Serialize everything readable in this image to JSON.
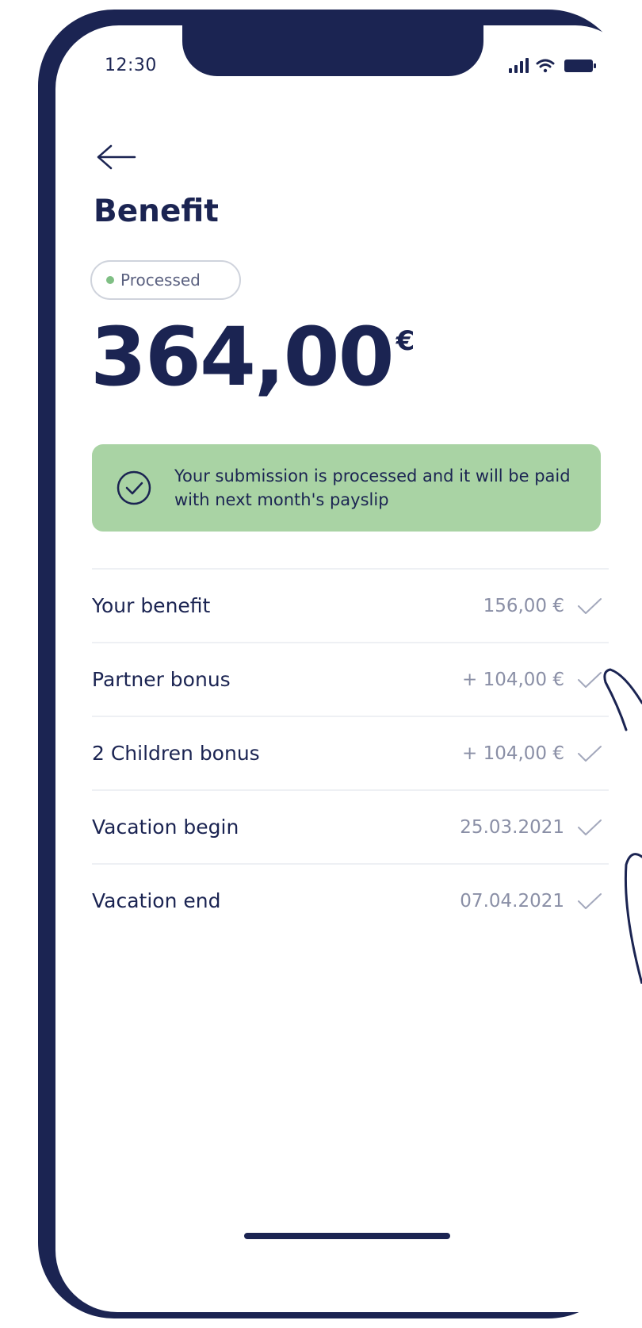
{
  "status_bar": {
    "time": "12:30"
  },
  "header": {
    "back_icon": "arrow-left-icon",
    "title": "Benefit"
  },
  "status_badge": {
    "label": "Processed",
    "dot_color": "#7fbf84"
  },
  "amount": {
    "value": "364,00",
    "currency": "€"
  },
  "info_banner": {
    "icon": "check-circle-icon",
    "message": "Your submission is processed and it will be paid with next month's payslip",
    "background": "#a9d3a4"
  },
  "rows": [
    {
      "label": "Your benefit",
      "value": "156,00 €"
    },
    {
      "label": "Partner bonus",
      "value": "+ 104,00 €"
    },
    {
      "label": "2 Children bonus",
      "value": "+ 104,00 €"
    },
    {
      "label": "Vacation begin",
      "value": "25.03.2021"
    },
    {
      "label": "Vacation end",
      "value": "07.04.2021"
    }
  ],
  "colors": {
    "primary": "#1b2452",
    "muted": "#8a8fa6",
    "success": "#a9d3a4"
  }
}
